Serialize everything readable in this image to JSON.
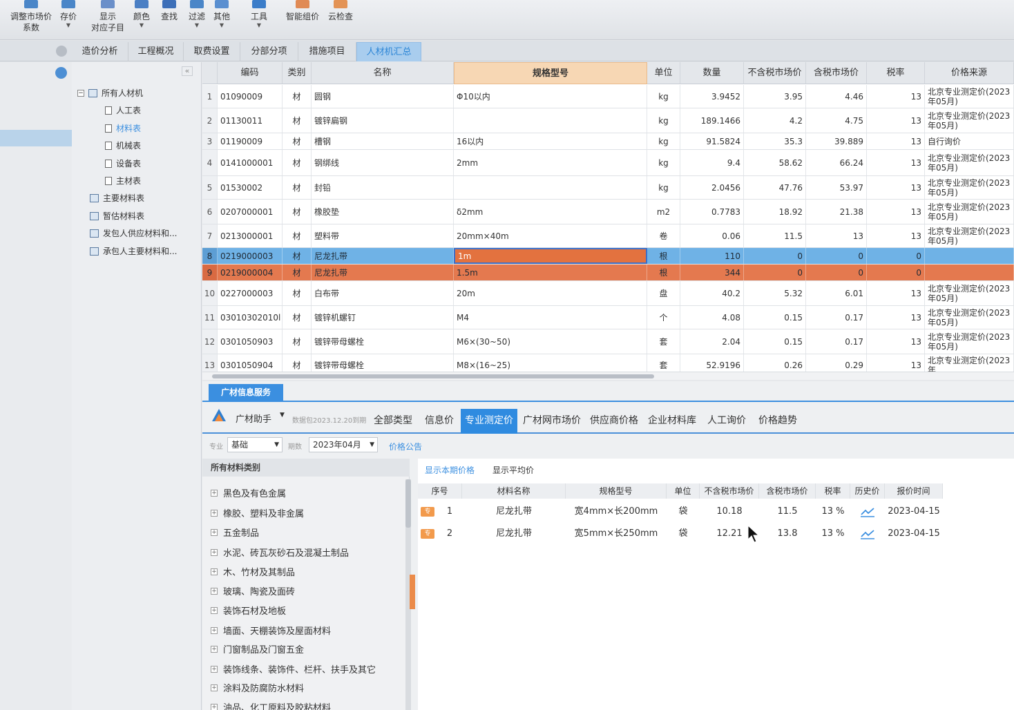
{
  "toolbar": {
    "items": [
      {
        "label": "调整市场价",
        "label2": "系数",
        "icon": "adjust-price-icon",
        "color": "#4a86c8"
      },
      {
        "label": "存价",
        "label2": "",
        "icon": "save-price-icon",
        "color": "#4a86c8"
      },
      {
        "label": "显示",
        "label2": "对应子目",
        "icon": "show-item-icon",
        "color": "#6a8fc9"
      },
      {
        "label": "颜色",
        "label2": "",
        "icon": "color-icon",
        "color": "#4a7fc4"
      },
      {
        "label": "查找",
        "label2": "",
        "icon": "find-icon",
        "color": "#3d6fb8"
      },
      {
        "label": "过滤",
        "label2": "",
        "icon": "filter-icon",
        "color": "#4a86c8"
      },
      {
        "label": "其他",
        "label2": "",
        "icon": "other-icon",
        "color": "#5a8fd0"
      },
      {
        "label": "工具",
        "label2": "",
        "icon": "tool-icon",
        "color": "#3b7dc9"
      },
      {
        "label": "智能组价",
        "label2": "",
        "icon": "smart-price-icon",
        "color": "#e08a55"
      },
      {
        "label": "云检查",
        "label2": "",
        "icon": "cloud-check-icon",
        "color": "#e39355"
      }
    ]
  },
  "tabs": [
    "造价分析",
    "工程概况",
    "取费设置",
    "分部分项",
    "措施项目",
    "人材机汇总"
  ],
  "tree": {
    "root": "所有人材机",
    "children": [
      "人工表",
      "材料表",
      "机械表",
      "设备表",
      "主材表"
    ],
    "others": [
      "主要材料表",
      "暂估材料表",
      "发包人供应材料和...",
      "承包人主要材料和..."
    ]
  },
  "grid": {
    "headers": [
      "编码",
      "类别",
      "名称",
      "规格型号",
      "单位",
      "数量",
      "不含税市场价",
      "含税市场价",
      "税率",
      "价格来源"
    ],
    "rows": [
      {
        "no": "1",
        "code": "01090009",
        "type": "材",
        "name": "圆钢",
        "spec": "Φ10以内",
        "unit": "kg",
        "qty": "3.9452",
        "ex": "3.95",
        "inc": "4.46",
        "rate": "13",
        "src": "北京专业测定价(2023年05月)"
      },
      {
        "no": "2",
        "code": "01130011",
        "type": "材",
        "name": "镀锌扁钢",
        "spec": "",
        "unit": "kg",
        "qty": "189.1466",
        "ex": "4.2",
        "inc": "4.75",
        "rate": "13",
        "src": "北京专业测定价(2023年05月)"
      },
      {
        "no": "3",
        "code": "01190009",
        "type": "材",
        "name": "槽钢",
        "spec": "16以内",
        "unit": "kg",
        "qty": "91.5824",
        "ex": "35.3",
        "inc": "39.889",
        "rate": "13",
        "src": "自行询价"
      },
      {
        "no": "4",
        "code": "0141000001",
        "type": "材",
        "name": "钢绑线",
        "spec": "2mm",
        "unit": "kg",
        "qty": "9.4",
        "ex": "58.62",
        "inc": "66.24",
        "rate": "13",
        "src": "北京专业测定价(2023年05月)"
      },
      {
        "no": "5",
        "code": "01530002",
        "type": "材",
        "name": "封铅",
        "spec": "",
        "unit": "kg",
        "qty": "2.0456",
        "ex": "47.76",
        "inc": "53.97",
        "rate": "13",
        "src": "北京专业测定价(2023年05月)"
      },
      {
        "no": "6",
        "code": "0207000001",
        "type": "材",
        "name": "橡胶垫",
        "spec": "δ2mm",
        "unit": "m2",
        "qty": "0.7783",
        "ex": "18.92",
        "inc": "21.38",
        "rate": "13",
        "src": "北京专业测定价(2023年05月)"
      },
      {
        "no": "7",
        "code": "0213000001",
        "type": "材",
        "name": "塑料带",
        "spec": "20mm×40m",
        "unit": "卷",
        "qty": "0.06",
        "ex": "11.5",
        "inc": "13",
        "rate": "13",
        "src": "北京专业测定价(2023年05月)"
      },
      {
        "no": "8",
        "code": "0219000003",
        "type": "材",
        "name": "尼龙扎带",
        "spec": "1m",
        "unit": "根",
        "qty": "110",
        "ex": "0",
        "inc": "0",
        "rate": "0",
        "src": ""
      },
      {
        "no": "9",
        "code": "0219000004",
        "type": "材",
        "name": "尼龙扎带",
        "spec": "1.5m",
        "unit": "根",
        "qty": "344",
        "ex": "0",
        "inc": "0",
        "rate": "0",
        "src": ""
      },
      {
        "no": "10",
        "code": "0227000003",
        "type": "材",
        "name": "白布带",
        "spec": "20m",
        "unit": "盘",
        "qty": "40.2",
        "ex": "5.32",
        "inc": "6.01",
        "rate": "13",
        "src": "北京专业测定价(2023年05月)"
      },
      {
        "no": "11",
        "code": "03010302010l",
        "type": "材",
        "name": "镀锌机螺钉",
        "spec": "M4",
        "unit": "个",
        "qty": "4.08",
        "ex": "0.15",
        "inc": "0.17",
        "rate": "13",
        "src": "北京专业测定价(2023年05月)"
      },
      {
        "no": "12",
        "code": "0301050903",
        "type": "材",
        "name": "镀锌带母螺栓",
        "spec": "M6×(30~50)",
        "unit": "套",
        "qty": "2.04",
        "ex": "0.15",
        "inc": "0.17",
        "rate": "13",
        "src": "北京专业测定价(2023年05月)"
      },
      {
        "no": "13",
        "code": "0301050904",
        "type": "材",
        "name": "镀锌带母螺栓",
        "spec": "M8×(16~25)",
        "unit": "套",
        "qty": "52.9196",
        "ex": "0.26",
        "inc": "0.29",
        "rate": "13",
        "src": "北京专业测定价(2023年"
      }
    ]
  },
  "bottom": {
    "service_tab": "广材信息服务",
    "assistant": "广材助手",
    "data_note": "数据包2023.12.20到期",
    "nav": [
      "全部类型",
      "信息价",
      "专业测定价",
      "广材网市场价",
      "供应商价格",
      "企业材料库",
      "人工询价",
      "价格趋势"
    ],
    "filter": {
      "major_label": "专业",
      "major_value": "基础",
      "period_label": "期数",
      "period_value": "2023年04月",
      "notice": "价格公告"
    },
    "categories_head": "所有材料类别",
    "categories": [
      "黑色及有色金属",
      "橡胶、塑料及非金属",
      "五金制品",
      "水泥、砖瓦灰砂石及混凝土制品",
      "木、竹材及其制品",
      "玻璃、陶瓷及面砖",
      "装饰石材及地板",
      "墙面、天棚装饰及屋面材料",
      "门窗制品及门窗五金",
      "装饰线条、装饰件、栏杆、扶手及其它",
      "涂料及防腐防水材料",
      "油品、化工原料及胶粘材料"
    ],
    "price_tabs": [
      "显示本期价格",
      "显示平均价"
    ],
    "price_headers": [
      "序号",
      "材料名称",
      "规格型号",
      "单位",
      "不含税市场价",
      "含税市场价",
      "税率",
      "历史价",
      "报价时间"
    ],
    "price_rows": [
      {
        "no": "1",
        "name": "尼龙扎带",
        "spec": "宽4mm×长200mm",
        "unit": "袋",
        "ex": "10.18",
        "inc": "11.5",
        "rate": "13 %",
        "time": "2023-04-15",
        "tag": "专"
      },
      {
        "no": "2",
        "name": "尼龙扎带",
        "spec": "宽5mm×长250mm",
        "unit": "袋",
        "ex": "12.21",
        "inc": "13.8",
        "rate": "13 %",
        "time": "2023-04-15",
        "tag": "专"
      }
    ]
  },
  "colors": {
    "accent": "#3b8fe0",
    "selected_row": "#6fb2e6",
    "highlight_row": "#e4794f",
    "spec_header": "#f7d7b4"
  }
}
